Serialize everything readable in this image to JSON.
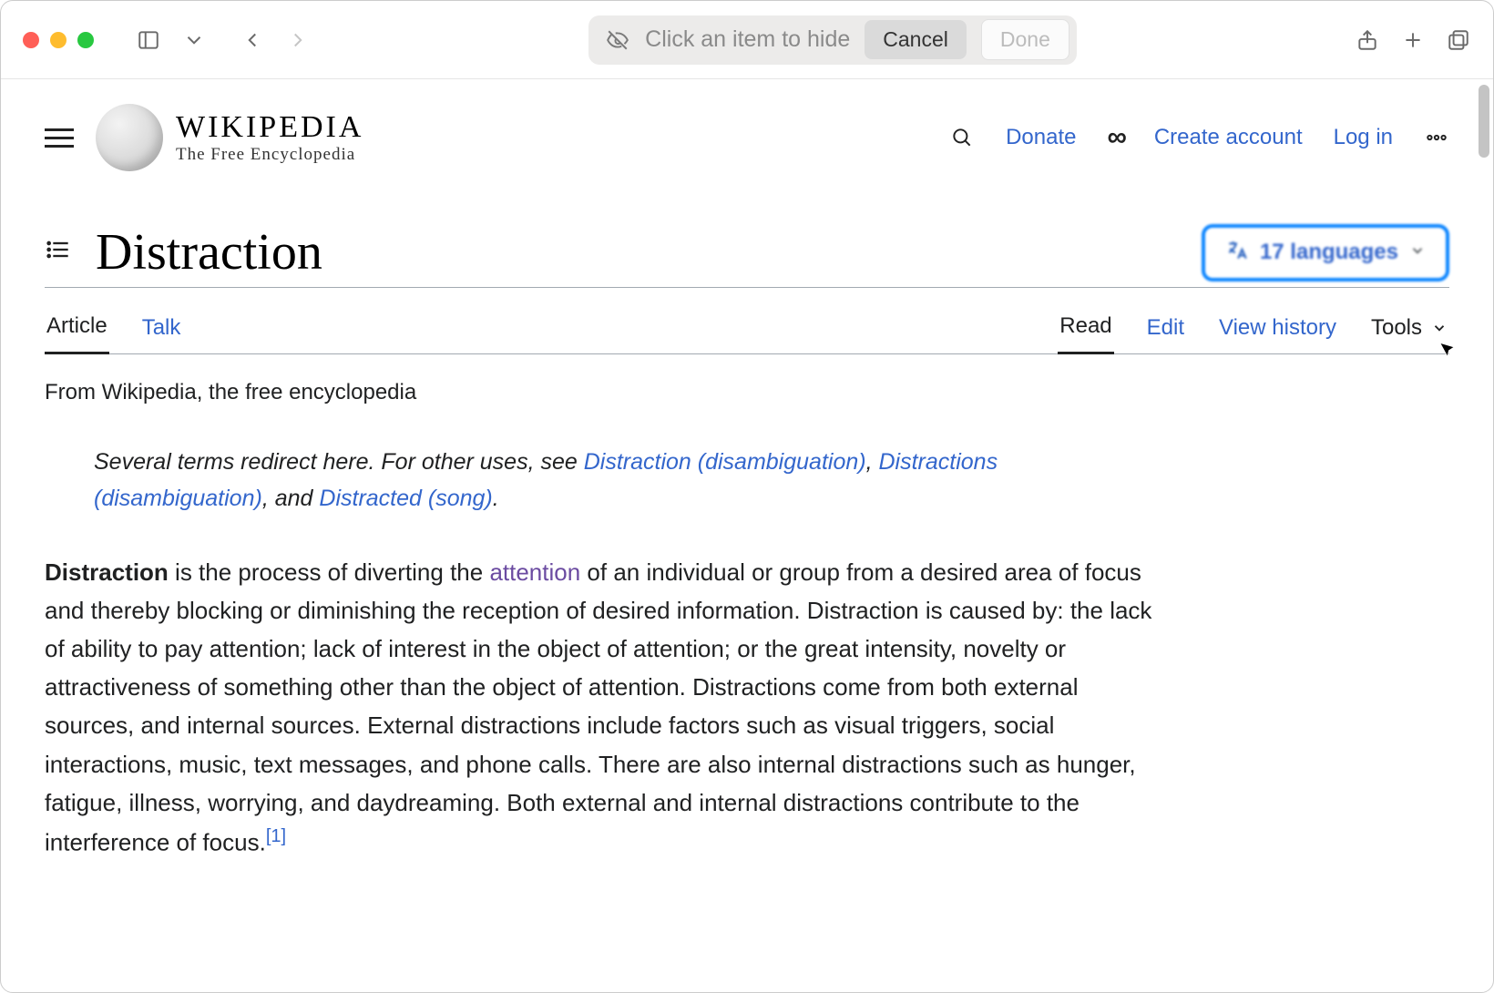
{
  "toolbar": {
    "hide_prompt": "Click an item to hide",
    "cancel_label": "Cancel",
    "done_label": "Done"
  },
  "wiki": {
    "wordmark": "WIKIPEDIA",
    "tagline": "The Free Encyclopedia",
    "links": {
      "donate": "Donate",
      "create_account": "Create account",
      "log_in": "Log in"
    }
  },
  "page": {
    "title": "Distraction",
    "languages_label": "17 languages",
    "tabs": {
      "article": "Article",
      "talk": "Talk",
      "read": "Read",
      "edit": "Edit",
      "view_history": "View history",
      "tools": "Tools"
    },
    "from_line": "From Wikipedia, the free encyclopedia",
    "hatnote": {
      "prefix": "Several terms redirect here. For other uses, see ",
      "link1": "Distraction (disambiguation)",
      "sep1": ", ",
      "link2": "Distractions (disambiguation)",
      "sep2": ", and ",
      "link3": "Distracted (song)",
      "suffix": "."
    },
    "lead": {
      "b": "Distraction",
      "t1": " is the process of diverting the ",
      "link_attention": "attention",
      "t2": " of an individual or group from a desired area of focus and thereby blocking or diminishing the reception of desired information. Distraction is caused by: the lack of ability to pay attention; lack of interest in the object of attention; or the great intensity, novelty or attractiveness of something other than the object of attention. Distractions come from both external sources, and internal sources. External distractions include factors such as visual triggers, social interactions, music, text messages, and phone calls. There are also internal distractions such as hunger, fatigue, illness, worrying, and daydreaming. Both external and internal distractions contribute to the interference of focus.",
      "ref": "[1]"
    }
  }
}
